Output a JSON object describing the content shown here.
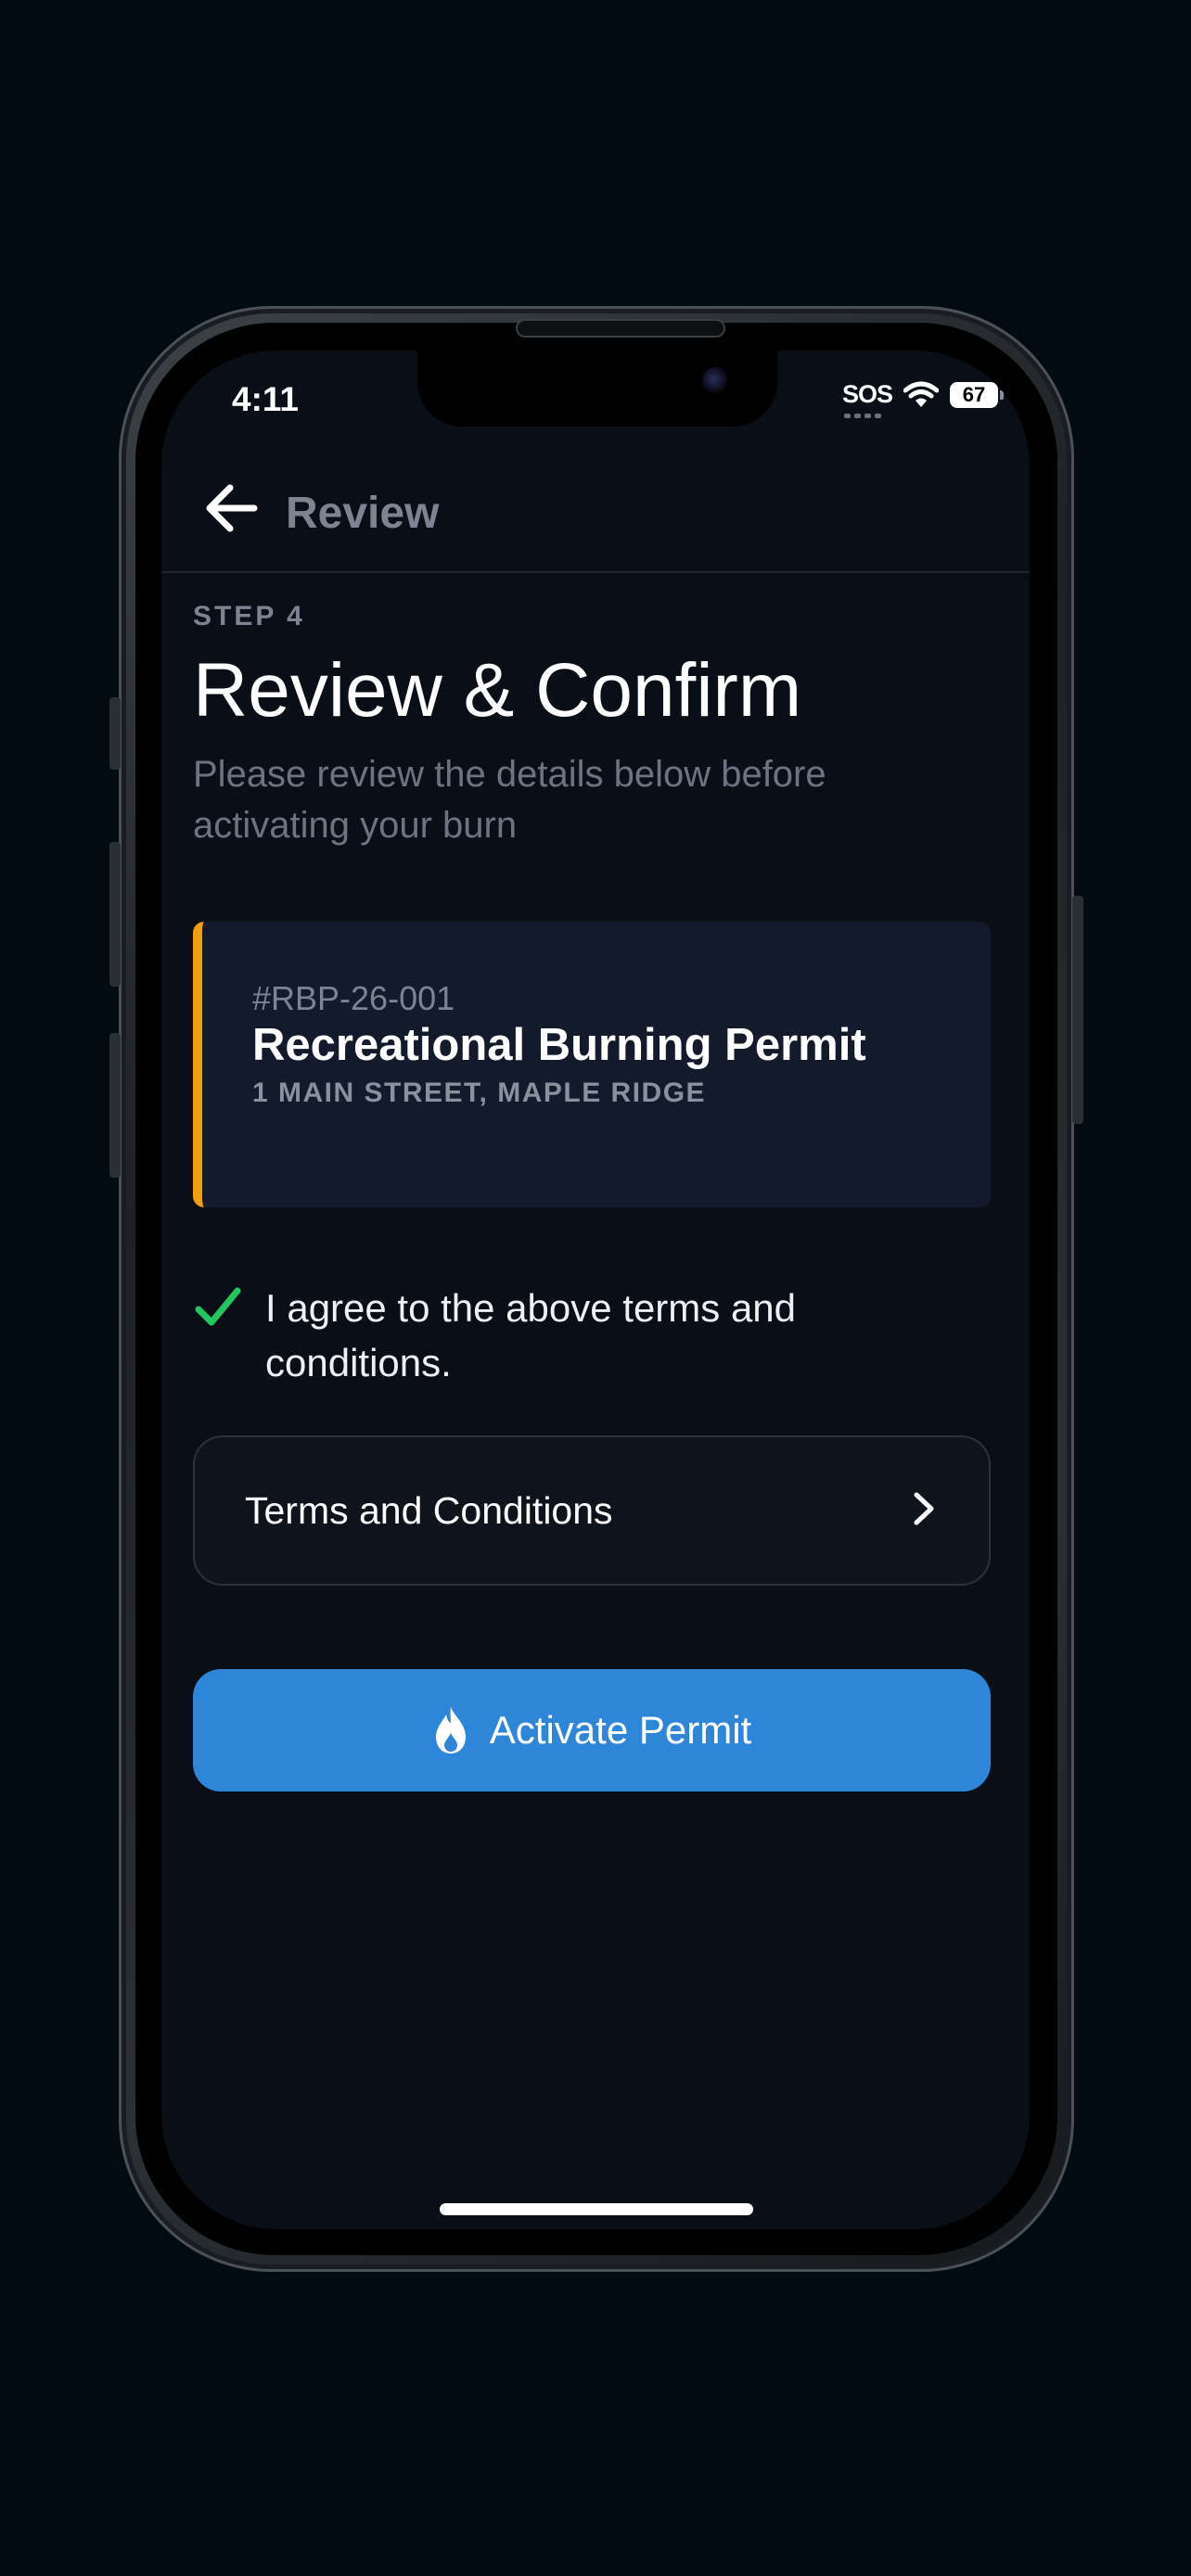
{
  "status_bar": {
    "time": "4:11",
    "carrier": "SOS",
    "battery": "67"
  },
  "nav": {
    "title": "Review"
  },
  "main": {
    "step_label": "STEP 4",
    "title": "Review & Confirm",
    "subtitle": "Please review the details below before activating your burn"
  },
  "permit": {
    "number": "#RBP-26-001",
    "title": "Recreational Burning Permit",
    "address": "1 MAIN STREET, MAPLE RIDGE",
    "accent_color": "#f59e0b"
  },
  "agreement": {
    "checked": true,
    "text": "I agree to the above terms and conditions."
  },
  "terms": {
    "label": "Terms and Conditions"
  },
  "activate": {
    "label": "Activate Permit",
    "color": "#2e86d8"
  },
  "icons": [
    "back-arrow-icon",
    "checkmark-icon",
    "chevron-right-icon",
    "flame-icon",
    "wifi-icon",
    "battery-icon"
  ]
}
